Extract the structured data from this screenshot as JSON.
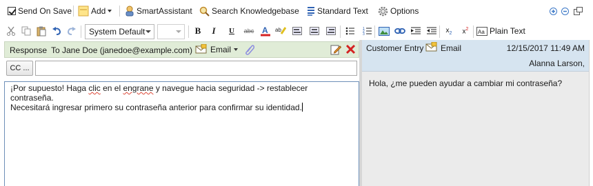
{
  "toolbar": {
    "send_on_save": "Send On Save",
    "add": "Add",
    "smart_assistant": "SmartAssistant",
    "search_kb": "Search Knowledgebase",
    "standard_text": "Standard Text",
    "options": "Options"
  },
  "format": {
    "font": "System Default",
    "size": "",
    "plain_text": "Plain Text"
  },
  "response": {
    "label": "Response",
    "to": "To Jane Doe (janedoe@example.com)",
    "channel": "Email",
    "cc_button": "CC ...",
    "cc_value": "",
    "line1_a": "¡Por supuesto! Haga ",
    "line1_b": "clic",
    "line1_c": " en el ",
    "line1_d": "engrane",
    "line1_e": " y navegue hacia seguridad -> restablecer contraseña.",
    "line2": "Necesitará ingresar primero su contraseña anterior para confirmar su identidad."
  },
  "customer": {
    "label": "Customer Entry",
    "channel": "Email",
    "timestamp": "12/15/2017 11:49 AM",
    "author": "Alanna Larson,",
    "message": "Hola, ¿me pueden ayudar a cambiar mi contraseña?"
  },
  "colors": {
    "response_header": "#e0ecd7",
    "customer_header": "#d6e4f0",
    "customer_body": "#ebebeb"
  }
}
